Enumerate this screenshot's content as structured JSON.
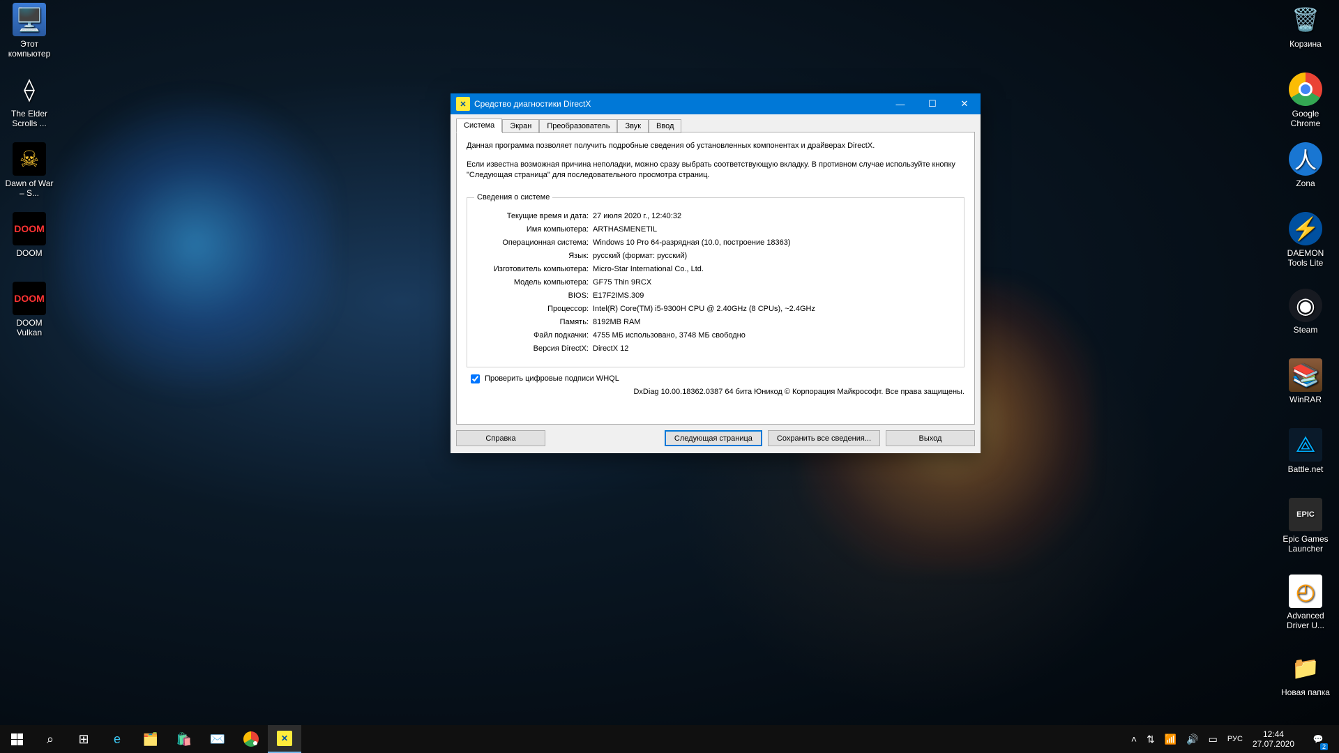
{
  "desktop": {
    "left_icons": [
      {
        "label": "Этот\nкомпьютер",
        "kind": "pc"
      },
      {
        "label": "The Elder Scrolls ...",
        "kind": "skyrim"
      },
      {
        "label": "Dawn of War – S...",
        "kind": "dow"
      },
      {
        "label": "DOOM",
        "kind": "doom"
      },
      {
        "label": "DOOM Vulkan",
        "kind": "doom"
      }
    ],
    "right_icons": [
      {
        "label": "Корзина",
        "kind": "recycle"
      },
      {
        "label": "Google Chrome",
        "kind": "chrome"
      },
      {
        "label": "Zona",
        "kind": "zona"
      },
      {
        "label": "DAEMON Tools Lite",
        "kind": "daemon"
      },
      {
        "label": "Steam",
        "kind": "steam"
      },
      {
        "label": "WinRAR",
        "kind": "winrar"
      },
      {
        "label": "Battle.net",
        "kind": "battlenet"
      },
      {
        "label": "Epic Games Launcher",
        "kind": "epic"
      },
      {
        "label": "Advanced Driver U...",
        "kind": "adv"
      },
      {
        "label": "Новая папка",
        "kind": "folder"
      }
    ]
  },
  "window": {
    "title": "Средство диагностики DirectX",
    "tabs": [
      "Система",
      "Экран",
      "Преобразователь",
      "Звук",
      "Ввод"
    ],
    "active_tab": 0,
    "intro_line1": "Данная программа позволяет получить подробные сведения об установленных компонентах и драйверах DirectX.",
    "intro_line2": "Если известна возможная причина неполадки, можно сразу выбрать соответствующую вкладку. В противном случае используйте кнопку \"Следующая страница\" для последовательного просмотра страниц.",
    "group_title": "Сведения о системе",
    "rows": [
      {
        "k": "Текущие время и дата:",
        "v": "27 июля 2020 г., 12:40:32"
      },
      {
        "k": "Имя компьютера:",
        "v": "ARTHASMENETIL"
      },
      {
        "k": "Операционная система:",
        "v": "Windows 10 Pro 64-разрядная (10.0, построение 18363)"
      },
      {
        "k": "Язык:",
        "v": "русский (формат: русский)"
      },
      {
        "k": "Изготовитель компьютера:",
        "v": "Micro-Star International Co., Ltd."
      },
      {
        "k": "Модель компьютера:",
        "v": "GF75 Thin 9RCX"
      },
      {
        "k": "BIOS:",
        "v": "E17F2IMS.309"
      },
      {
        "k": "Процессор:",
        "v": "Intel(R) Core(TM) i5-9300H CPU @ 2.40GHz (8 CPUs), ~2.4GHz"
      },
      {
        "k": "Память:",
        "v": "8192MB RAM"
      },
      {
        "k": "Файл подкачки:",
        "v": "4755 МБ использовано, 3748 МБ свободно"
      },
      {
        "k": "Версия DirectX:",
        "v": "DirectX 12"
      }
    ],
    "whql_label": "Проверить цифровые подписи WHQL",
    "whql_checked": true,
    "copyright": "DxDiag 10.00.18362.0387 64 бита Юникод © Корпорация Майкрософт. Все права защищены.",
    "buttons": {
      "help": "Справка",
      "next": "Следующая страница",
      "save": "Сохранить все сведения...",
      "exit": "Выход"
    }
  },
  "taskbar": {
    "lang": "РУС",
    "time": "12:44",
    "date": "27.07.2020",
    "notif_count": "2"
  }
}
